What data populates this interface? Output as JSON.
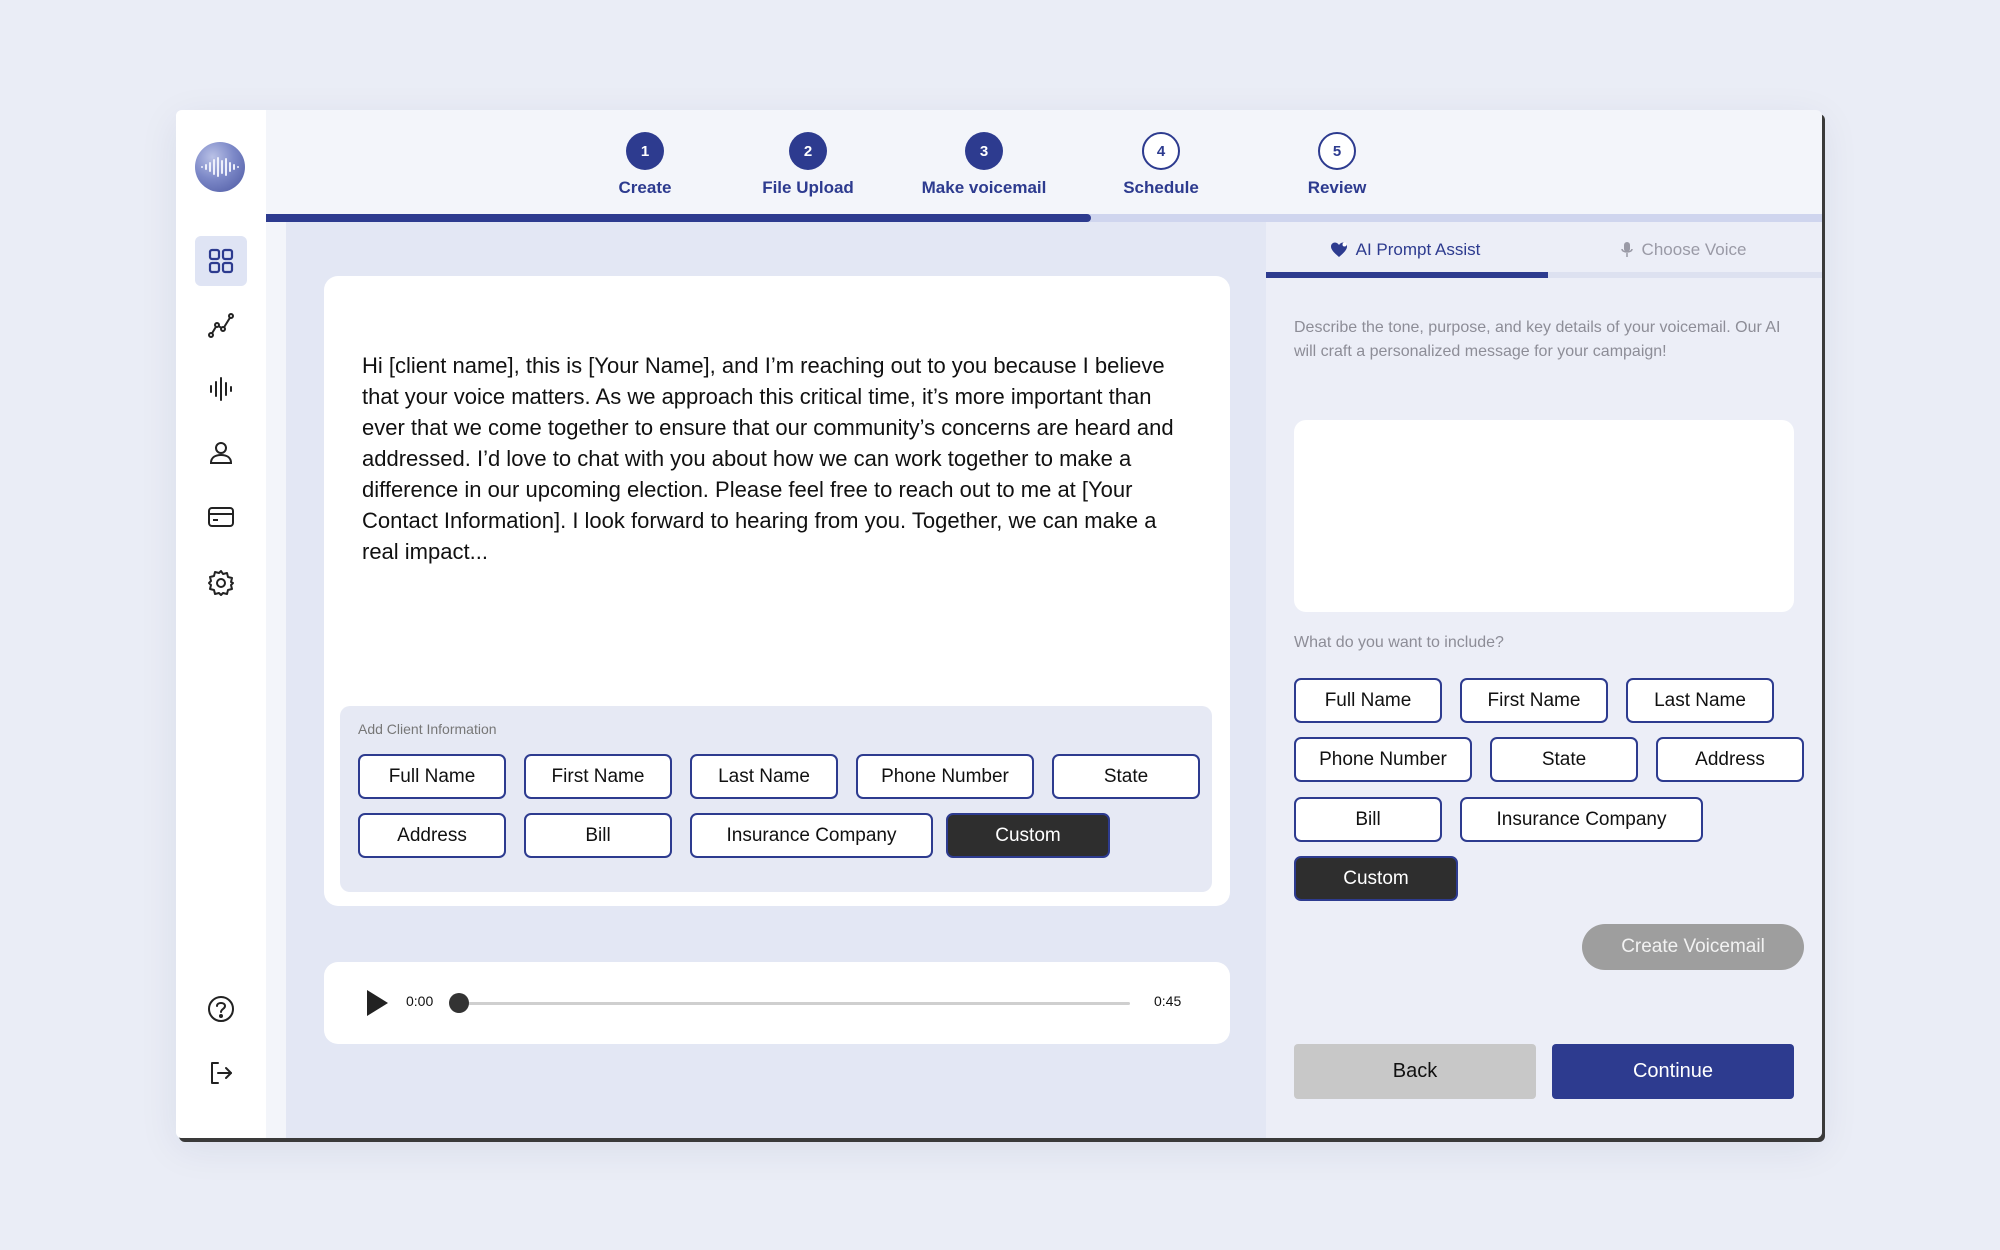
{
  "stepper": {
    "steps": [
      {
        "number": "1",
        "label": "Create",
        "state": "done"
      },
      {
        "number": "2",
        "label": "File Upload",
        "state": "done"
      },
      {
        "number": "3",
        "label": "Make voicemail",
        "state": "done"
      },
      {
        "number": "4",
        "label": "Schedule",
        "state": "todo"
      },
      {
        "number": "5",
        "label": "Review",
        "state": "todo"
      }
    ],
    "progress_percent": 53
  },
  "sidebar": {
    "items": [
      {
        "icon": "dashboard-grid-icon",
        "active": true
      },
      {
        "icon": "analytics-icon",
        "active": false
      },
      {
        "icon": "audio-wave-icon",
        "active": false
      },
      {
        "icon": "user-icon",
        "active": false
      },
      {
        "icon": "credit-card-icon",
        "active": false
      },
      {
        "icon": "gear-icon",
        "active": false
      },
      {
        "icon": "help-icon",
        "active": false
      },
      {
        "icon": "logout-icon",
        "active": false
      }
    ]
  },
  "editor": {
    "message": "Hi [client name],  this is [Your Name], and I’m reaching out to you because I believe that your voice matters. As we approach this critical time, it’s more important than ever that we come together to ensure that our community’s concerns are heard and addressed. I’d love to chat with you about how we can work together to make a difference in our upcoming election. Please feel free to reach out to me at [Your Contact Information]. I look forward to hearing from you. Together, we can make a real impact..."
  },
  "client_info": {
    "label": "Add Client Information",
    "chips": [
      "Full Name",
      "First Name",
      "Last Name",
      "Phone Number",
      "State",
      "Address",
      "Bill",
      "Insurance Company",
      "Custom"
    ]
  },
  "audio": {
    "current_time": "0:00",
    "duration": "0:45",
    "progress_fraction": 0
  },
  "right_panel": {
    "tabs": [
      {
        "label": "AI Prompt Assist",
        "active": true,
        "icon": "ai-heart-icon"
      },
      {
        "label": "Choose Voice",
        "active": false,
        "icon": "microphone-icon"
      }
    ],
    "description": "Describe the tone, purpose, and key details of your voicemail. Our AI will craft a personalized message for your campaign!",
    "prompt_placeholder": "",
    "include_label": "What do you want to include?",
    "chips": [
      "Full Name",
      "First Name",
      "Last Name",
      "Phone Number",
      "State",
      "Address",
      "Bill",
      "Insurance Company",
      "Custom"
    ],
    "create_button": "Create Voicemail",
    "back_button": "Back",
    "continue_button": "Continue"
  },
  "colors": {
    "brand": "#2d3b8f",
    "background": "#eaedf6",
    "dark_chip": "#2e2e2e"
  }
}
